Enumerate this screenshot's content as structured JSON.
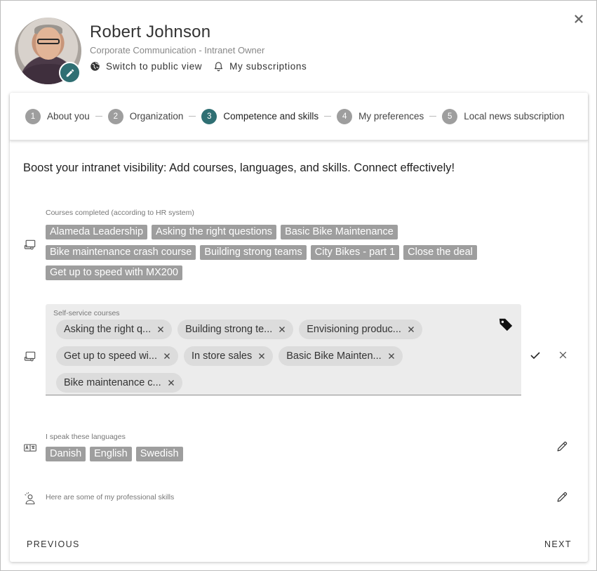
{
  "profile": {
    "name": "Robert Johnson",
    "role": "Corporate Communication - Intranet Owner",
    "links": [
      {
        "label": "Switch to public view",
        "icon": "globe-icon"
      },
      {
        "label": "My subscriptions",
        "icon": "bell-icon"
      }
    ]
  },
  "stepper": {
    "steps": [
      {
        "num": "1",
        "label": "About you",
        "active": false
      },
      {
        "num": "2",
        "label": "Organization",
        "active": false
      },
      {
        "num": "3",
        "label": "Competence and skills",
        "active": true
      },
      {
        "num": "4",
        "label": "My preferences",
        "active": false
      },
      {
        "num": "5",
        "label": "Local news subscription",
        "active": false
      }
    ]
  },
  "content": {
    "intro": "Boost your intranet visibility: Add courses, languages, and skills. Connect effectively!",
    "courses": {
      "label": "Courses completed (according to HR system)",
      "items": [
        "Alameda Leadership",
        "Asking the right questions",
        "Basic Bike Maintenance",
        "Bike maintenance crash course",
        "Building strong teams",
        "City Bikes - part 1",
        "Close the deal",
        "Get up to speed with MX200"
      ]
    },
    "self_service": {
      "label": "Self-service courses",
      "items": [
        "Asking the right q...",
        "Building strong te...",
        "Envisioning produc...",
        "Get up to speed wi...",
        "In store sales",
        "Basic Bike Mainten...",
        "Bike maintenance c..."
      ]
    },
    "languages": {
      "label": "I speak these languages",
      "items": [
        "Danish",
        "English",
        "Swedish"
      ]
    },
    "skills": {
      "label": "Here are some of my professional skills"
    }
  },
  "nav": {
    "previous": "PREVIOUS",
    "next": "NEXT"
  },
  "colors": {
    "accent": "#2f6f73",
    "chip_gray": "#9e9e9e",
    "step_inactive": "#9e9e9e"
  }
}
